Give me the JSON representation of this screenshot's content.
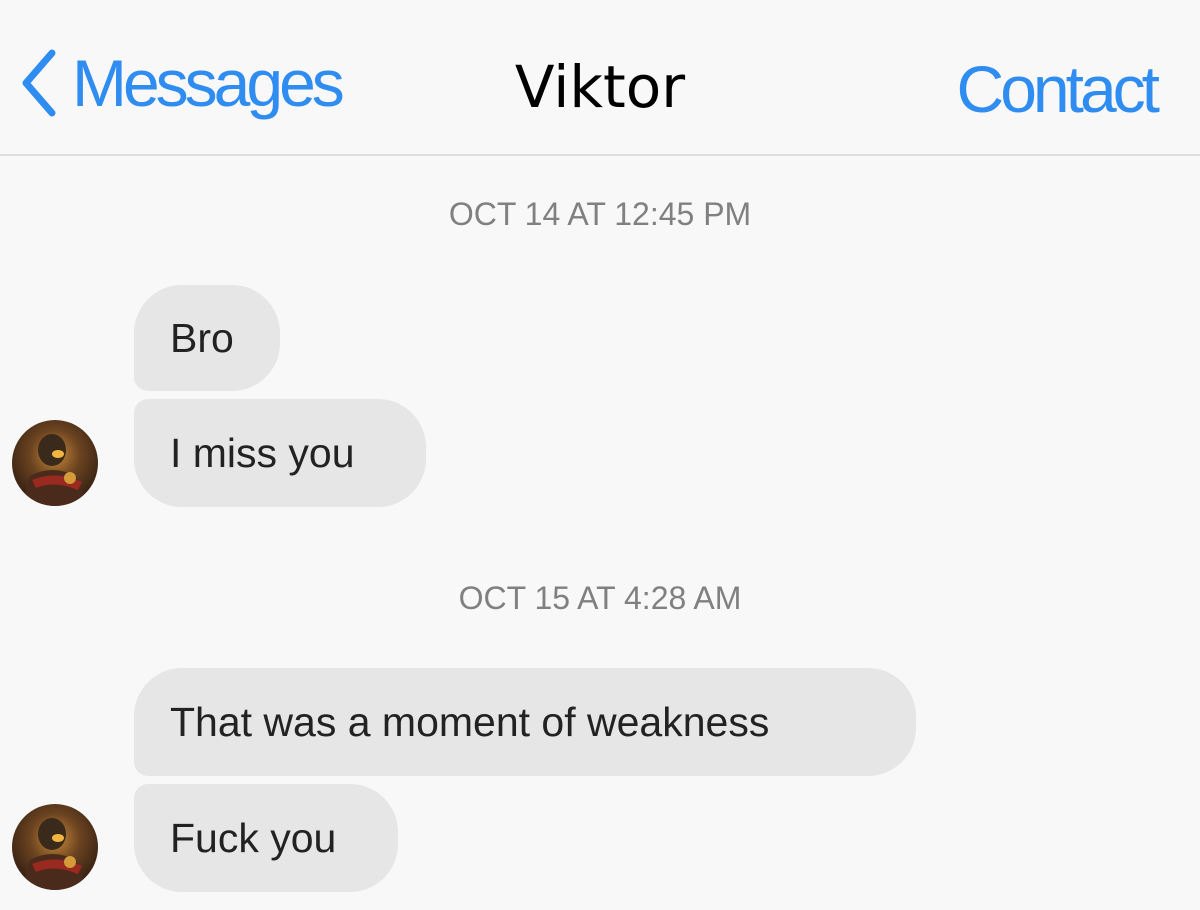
{
  "header": {
    "back_label": "Messages",
    "title": "Viktor",
    "contact_label": "Contact"
  },
  "conversation": {
    "groups": [
      {
        "timestamp": "OCT 14 AT 12:45 PM",
        "messages": [
          "Bro",
          "I miss you"
        ]
      },
      {
        "timestamp": "OCT 15 AT 4:28 AM",
        "messages": [
          "That was a moment of weakness",
          "Fuck you"
        ]
      }
    ]
  },
  "colors": {
    "accent": "#2f8cf0",
    "bubble": "#e6e6e6",
    "background": "#f8f8f8",
    "timestamp": "#808080"
  },
  "icons": {
    "back": "chevron-left-icon",
    "avatar": "contact-avatar"
  }
}
